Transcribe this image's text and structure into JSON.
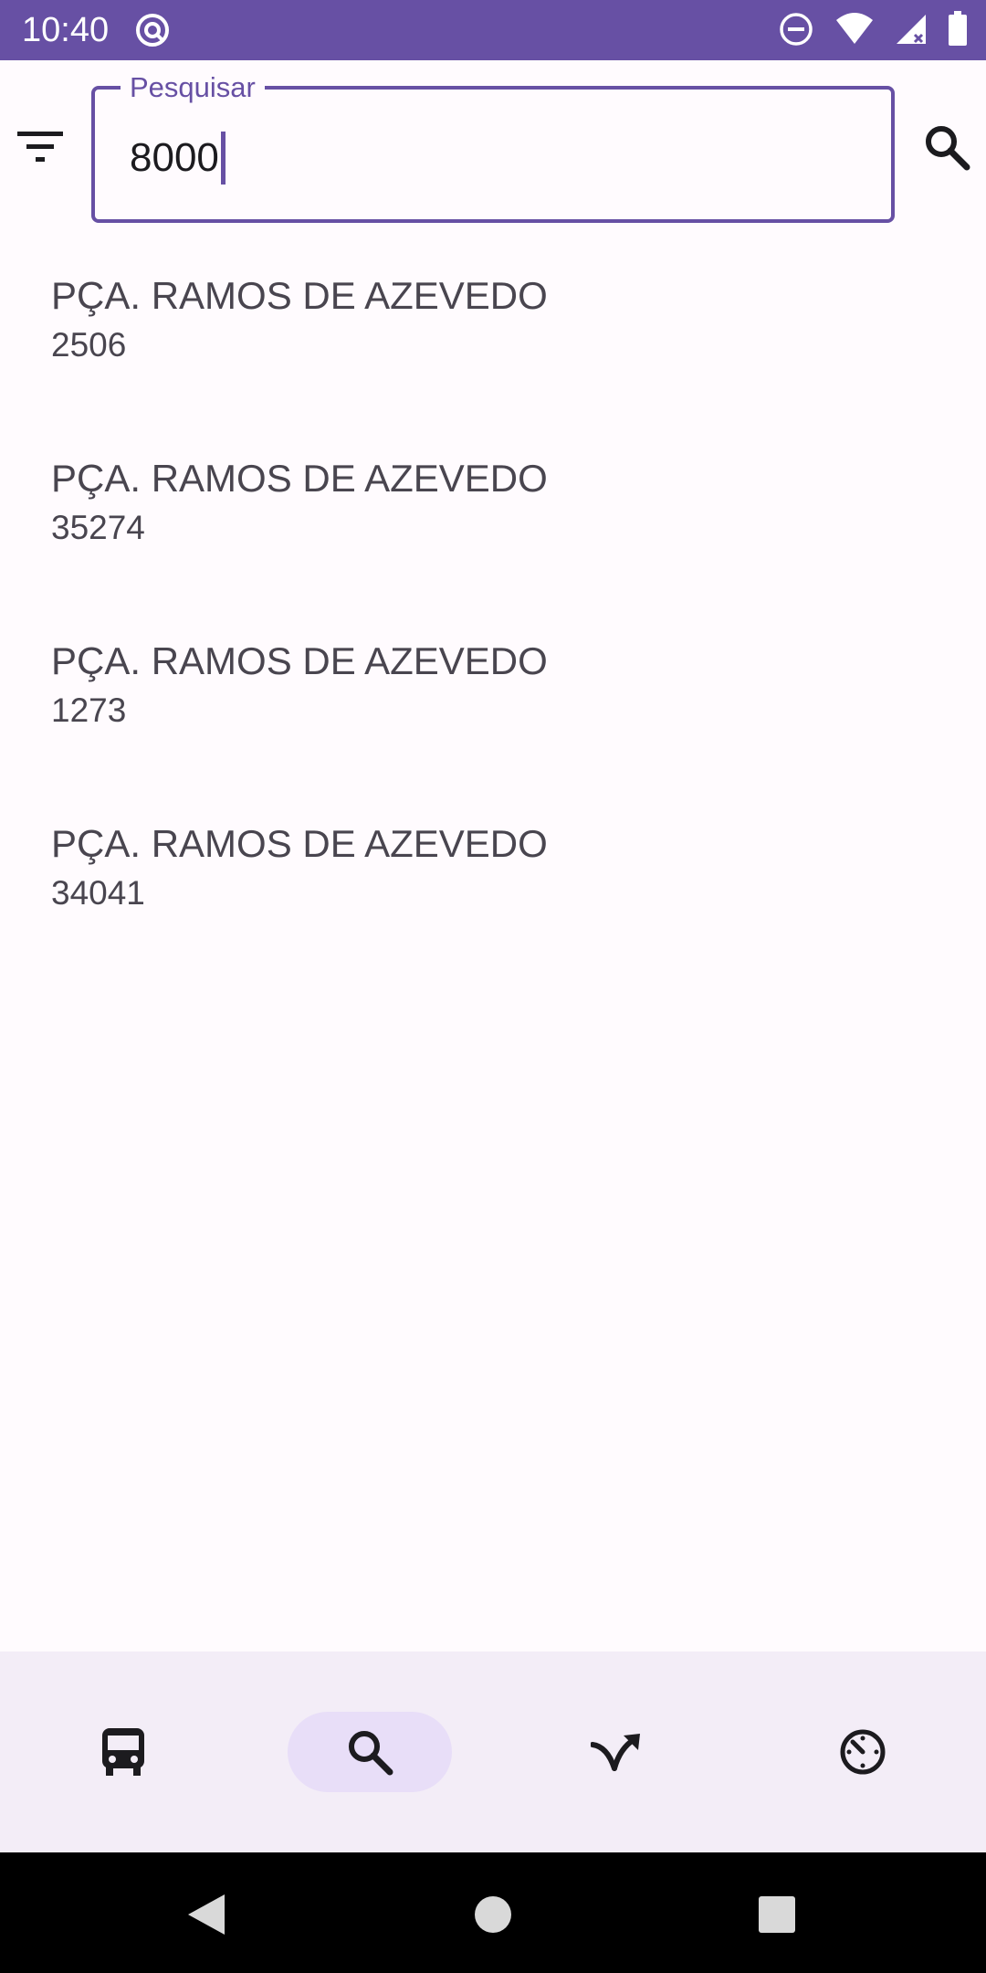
{
  "status_bar": {
    "time": "10:40",
    "icons": [
      "accessibility-icon",
      "do-not-disturb-icon",
      "wifi-icon",
      "signal-icon",
      "battery-icon"
    ],
    "background": "#6750a4"
  },
  "search": {
    "label": "Pesquisar",
    "value": "8000",
    "filter_icon": "filter-icon",
    "search_icon": "search-icon",
    "accent": "#6750a4"
  },
  "results": [
    {
      "title": "PÇA. RAMOS DE AZEVEDO",
      "subtitle": "2506"
    },
    {
      "title": "PÇA. RAMOS DE AZEVEDO",
      "subtitle": "35274"
    },
    {
      "title": "PÇA. RAMOS DE AZEVEDO",
      "subtitle": "1273"
    },
    {
      "title": "PÇA. RAMOS DE AZEVEDO",
      "subtitle": "34041"
    }
  ],
  "bottom_nav": {
    "items": [
      {
        "icon": "bus-icon",
        "active": false
      },
      {
        "icon": "search-icon",
        "active": true
      },
      {
        "icon": "route-icon",
        "active": false
      },
      {
        "icon": "timer-icon",
        "active": false
      }
    ],
    "active_background": "#e8def8"
  },
  "system_nav": {
    "icons": [
      "back-icon",
      "home-icon",
      "recents-icon"
    ]
  }
}
